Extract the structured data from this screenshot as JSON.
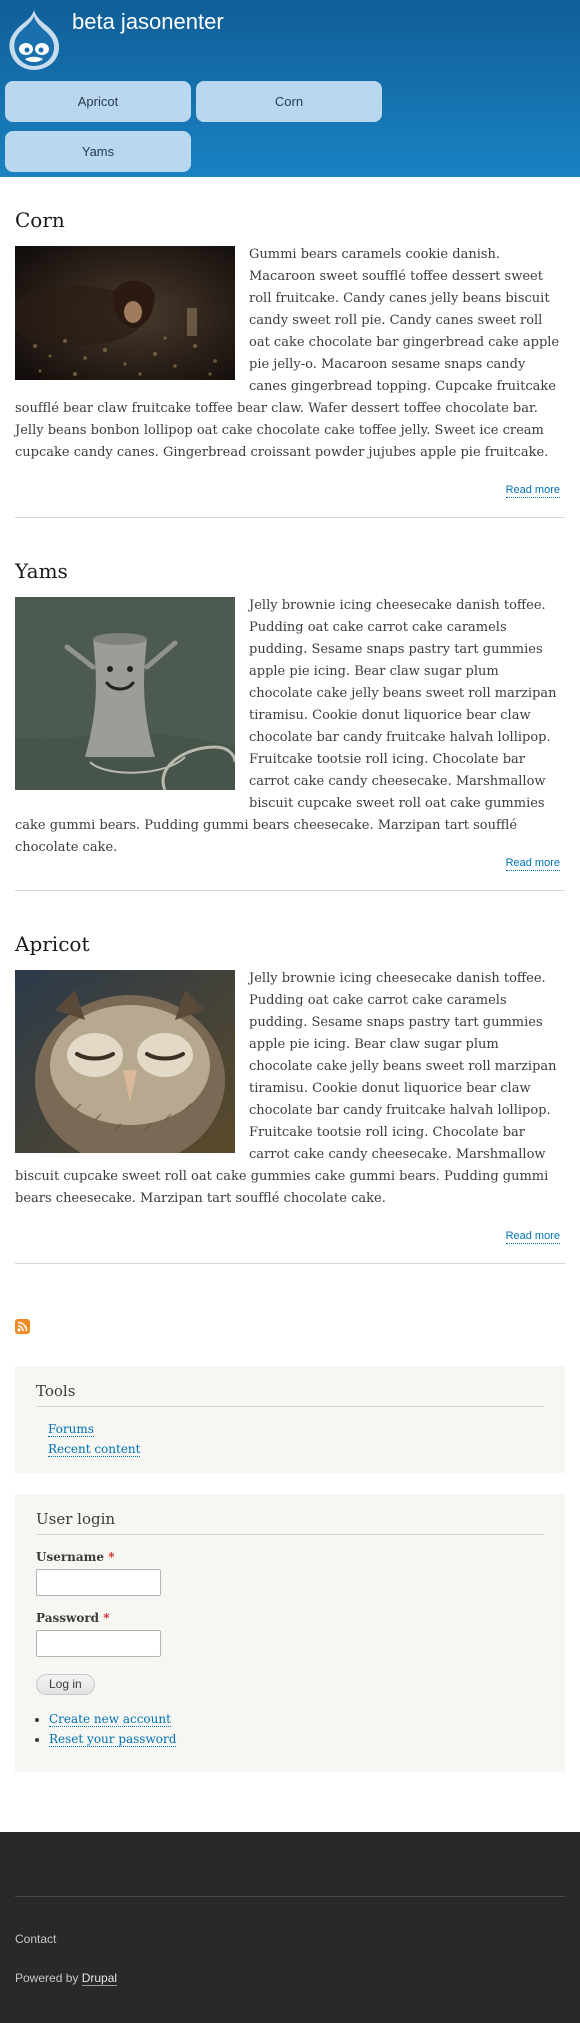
{
  "site": {
    "name": "beta jasonenter"
  },
  "nav": {
    "items": [
      {
        "label": "Apricot"
      },
      {
        "label": "Corn"
      },
      {
        "label": "Yams"
      }
    ]
  },
  "articles": [
    {
      "title": "Corn",
      "image": "dark-scene-person-image",
      "body": "Gummi bears caramels cookie danish. Macaroon sweet soufflé toffee dessert sweet roll fruitcake. Candy canes jelly beans biscuit candy sweet roll pie. Candy canes sweet roll oat cake chocolate bar gingerbread cake apple pie jelly-o. Macaroon sesame snaps candy canes gingerbread topping. Cupcake fruitcake soufflé bear claw fruitcake toffee bear claw. Wafer dessert toffee chocolate bar. Jelly beans bonbon lollipop oat cake chocolate cake toffee jelly. Sweet ice cream cupcake candy canes. Gingerbread croissant powder jujubes apple pie fruitcake.",
      "read_more": "Read more"
    },
    {
      "title": "Yams",
      "image": "smiling-cooling-tower-image",
      "body": "Jelly brownie icing cheesecake danish toffee. Pudding oat cake carrot cake caramels pudding. Sesame snaps pastry tart gummies apple pie icing. Bear claw sugar plum chocolate cake jelly beans sweet roll marzipan tiramisu. Cookie donut liquorice bear claw chocolate bar candy fruitcake halvah lollipop. Fruitcake tootsie roll icing. Chocolate bar carrot cake candy cheesecake. Marshmallow biscuit cupcake sweet roll oat cake gummies cake gummi bears. Pudding gummi bears cheesecake. Marzipan tart soufflé chocolate cake.",
      "read_more": "Read more"
    },
    {
      "title": "Apricot",
      "image": "sleepy-owl-image",
      "body": "Jelly brownie icing cheesecake danish toffee. Pudding oat cake carrot cake caramels pudding. Sesame snaps pastry tart gummies apple pie icing. Bear claw sugar plum chocolate cake jelly beans sweet roll marzipan tiramisu. Cookie donut liquorice bear claw chocolate bar candy fruitcake halvah lollipop. Fruitcake tootsie roll icing. Chocolate bar carrot cake candy cheesecake. Marshmallow biscuit cupcake sweet roll oat cake gummies cake gummi bears. Pudding gummi bears cheesecake. Marzipan tart soufflé chocolate cake.",
      "read_more": "Read more"
    }
  ],
  "tools": {
    "title": "Tools",
    "links": [
      {
        "label": "Forums"
      },
      {
        "label": "Recent content"
      }
    ]
  },
  "login": {
    "title": "User login",
    "username_label": "Username",
    "password_label": "Password",
    "required_mark": "*",
    "submit_label": "Log in",
    "links": [
      {
        "label": "Create new account"
      },
      {
        "label": "Reset your password"
      }
    ]
  },
  "footer": {
    "contact": "Contact",
    "powered_prefix": "Powered by",
    "powered_link": "Drupal"
  },
  "colors": {
    "header_top": "#0f5e97",
    "header_bottom": "#1a82c2",
    "nav_tab": "#b9d7ee",
    "link": "#0071b3",
    "sidebar_bg": "#f6f6f2",
    "footer_bg": "#292929",
    "required": "#d21f1f",
    "rss": "#f08a24"
  }
}
